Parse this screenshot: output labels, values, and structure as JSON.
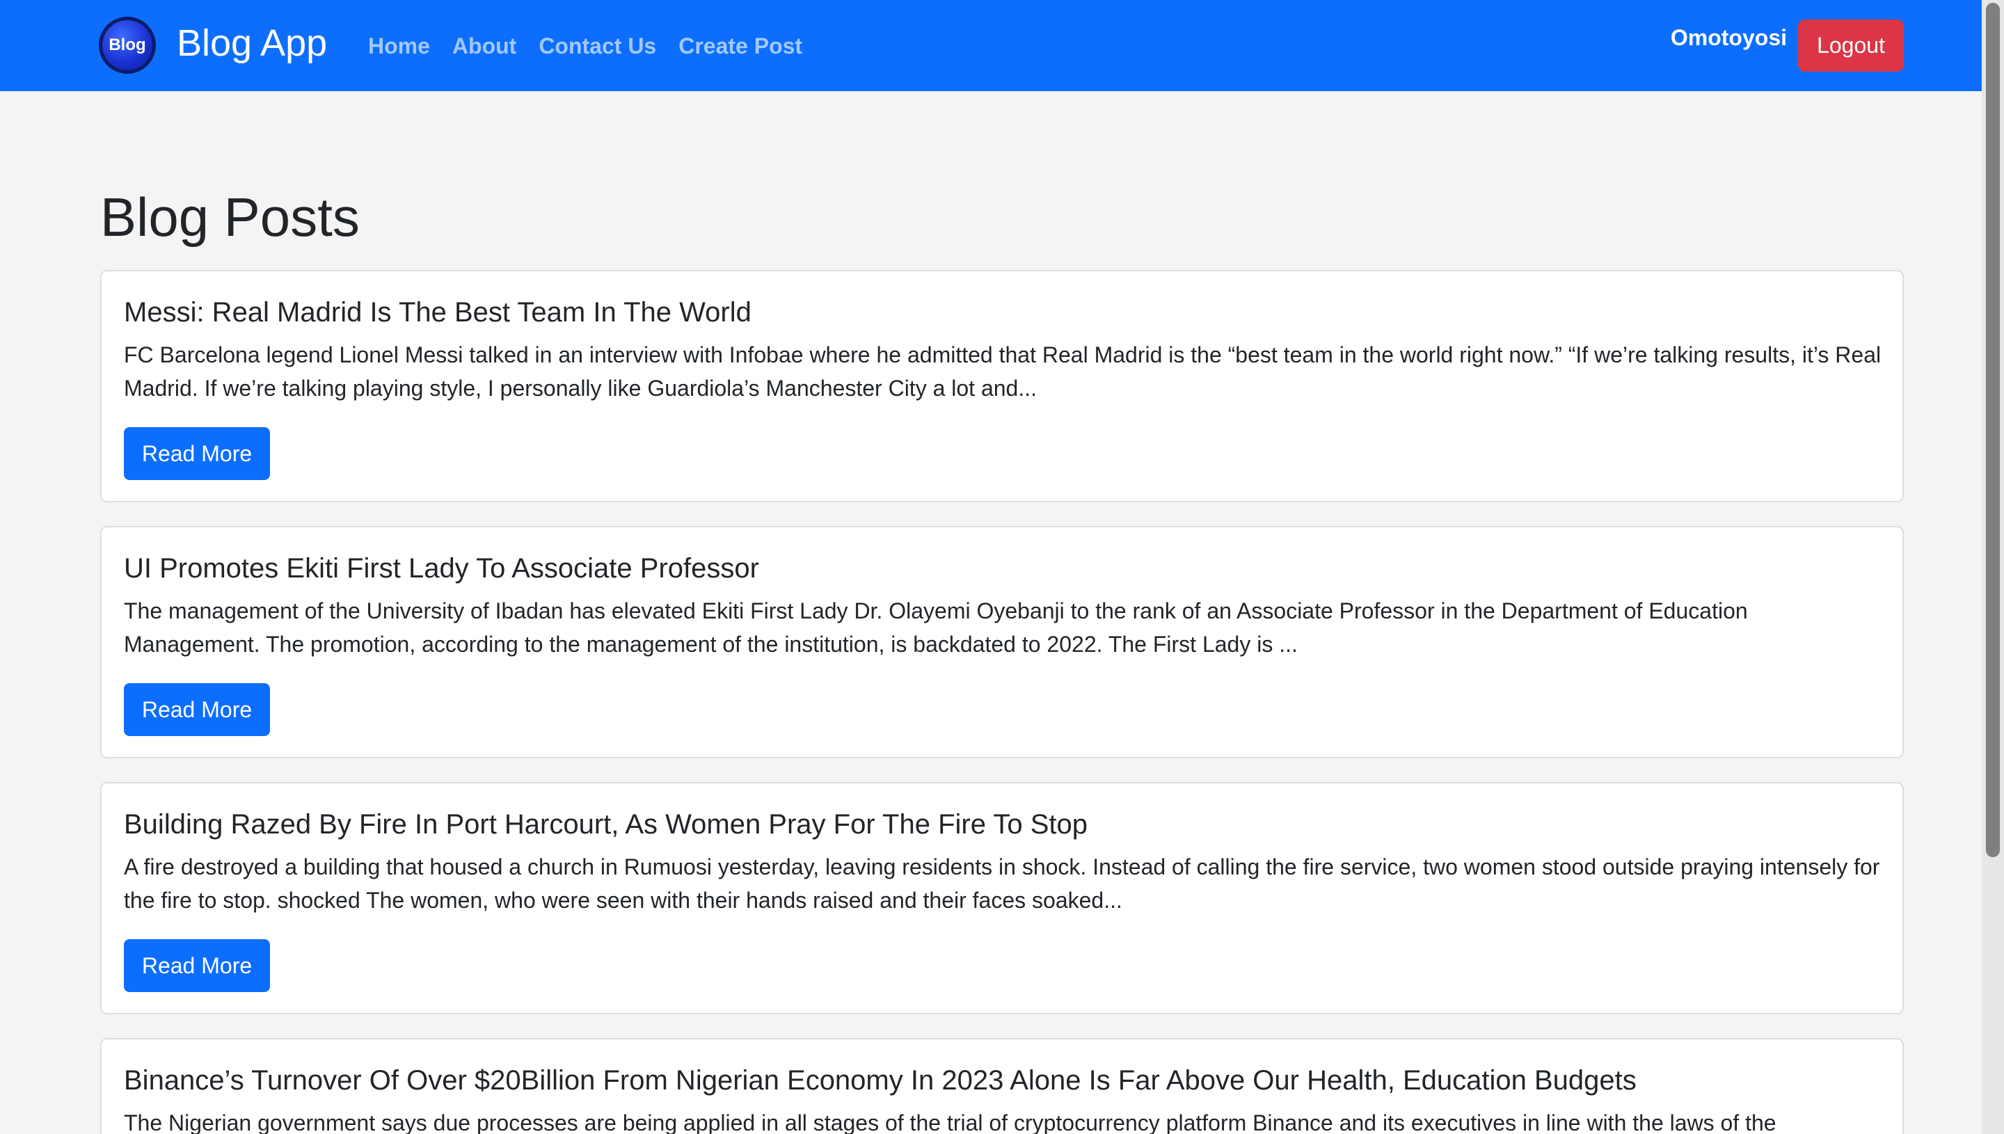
{
  "navbar": {
    "logo_text": "Blog",
    "brand": "Blog App",
    "links": [
      {
        "label": "Home"
      },
      {
        "label": "About"
      },
      {
        "label": "Contact Us"
      },
      {
        "label": "Create Post"
      }
    ],
    "username": "Omotoyosi",
    "logout_label": "Logout"
  },
  "main": {
    "title": "Blog Posts",
    "read_more_label": "Read More",
    "posts": [
      {
        "title": "Messi: Real Madrid Is The Best Team In The World",
        "excerpt": "FC Barcelona legend Lionel Messi talked in an interview with Infobae where he admitted that Real Madrid is the “best team in the world right now.” “If we’re talking results, it’s Real Madrid. If we’re talking playing style, I personally like Guardiola’s Manchester City a lot and..."
      },
      {
        "title": "UI Promotes Ekiti First Lady To Associate Professor",
        "excerpt": "The management of the University of Ibadan has elevated Ekiti First Lady Dr. Olayemi Oyebanji to the rank of an Associate Professor in the Department of Education Management. The promotion, according to the management of the institution, is backdated to 2022. The First Lady is ..."
      },
      {
        "title": "Building Razed By Fire In Port Harcourt, As Women Pray For The Fire To Stop",
        "excerpt": "A fire destroyed a building that housed a church in Rumuosi yesterday, leaving residents in shock. Instead of calling the fire service, two women stood outside praying intensely for the fire to stop. shocked The women, who were seen with their hands raised and their faces soaked..."
      },
      {
        "title": "Binance’s Turnover Of Over $20Billion From Nigerian Economy In 2023 Alone Is Far Above Our Health, Education Budgets",
        "excerpt": "The Nigerian government says due processes are being applied in all stages of the trial of cryptocurrency platform Binance and its executives in line with the laws of the"
      }
    ]
  },
  "colors": {
    "navbar_bg": "#0d6efd",
    "logout_bg": "#dc3545",
    "read_more_bg": "#0d6efd",
    "page_bg": "#f4f4f4"
  }
}
